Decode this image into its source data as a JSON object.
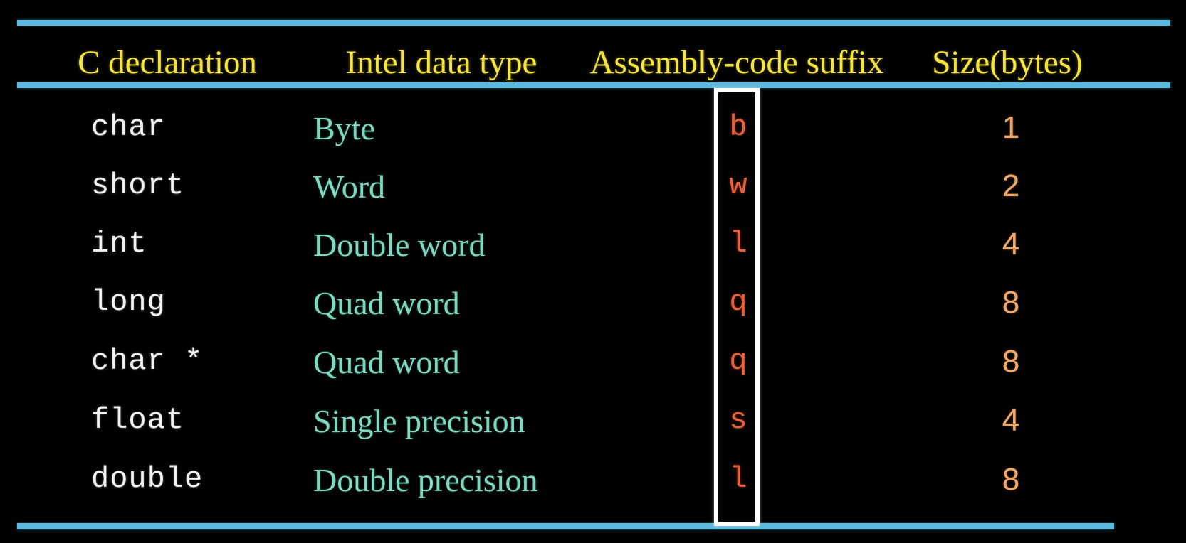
{
  "slide": {
    "background_color": "#000000",
    "rule_color": "#5CB8DC",
    "header_color": "#F5E53C",
    "declaration_color": "#F2F2F2",
    "type_color": "#7FD9C0",
    "suffix_color": "#E8603C",
    "size_color": "#F0A868",
    "highlight_color": "#FFFFFF"
  },
  "table": {
    "headers": [
      "C declaration",
      "Intel data type",
      "Assembly-code suffix",
      "Size(bytes)"
    ],
    "rows": [
      {
        "declaration": "char",
        "type": "Byte",
        "suffix": "b",
        "size": "1"
      },
      {
        "declaration": "short",
        "type": "Word",
        "suffix": "w",
        "size": "2"
      },
      {
        "declaration": "int",
        "type": "Double word",
        "suffix": "l",
        "size": "4"
      },
      {
        "declaration": "long",
        "type": "Quad word",
        "suffix": "q",
        "size": "8"
      },
      {
        "declaration": "char *",
        "type": "Quad word",
        "suffix": "q",
        "size": "8"
      },
      {
        "declaration": "float",
        "type": "Single precision",
        "suffix": "s",
        "size": "4"
      },
      {
        "declaration": "double",
        "type": "Double precision",
        "suffix": "l",
        "size": "8"
      }
    ]
  }
}
